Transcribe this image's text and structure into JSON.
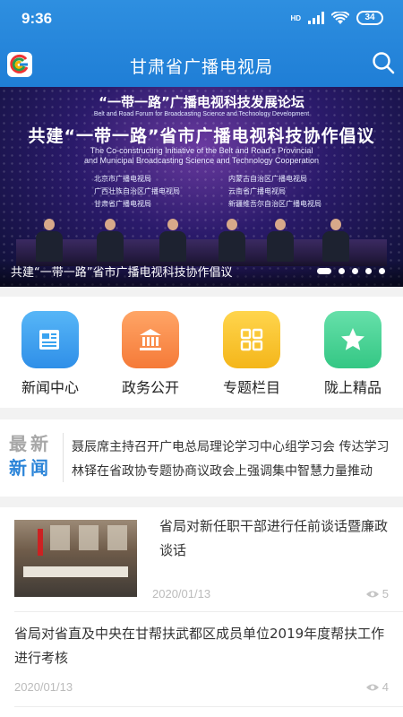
{
  "status_bar": {
    "time": "9:36",
    "network": "HD",
    "battery": "34"
  },
  "app_bar": {
    "title": "甘肃省广播电视局"
  },
  "banner": {
    "forum_title": "“一带一路”广播电视科技发展论坛",
    "forum_title_en": "Belt and Road Forum for Broadcasting Science and Technology Development",
    "headline": "共建“一带一路”省市广播电视科技协作倡议",
    "headline_en_1": "The Co-constructing Initiative of the Belt and Road's Provincial",
    "headline_en_2": "and Municipal Broadcasting Science and Technology Cooperation",
    "orgs_left": [
      "北京市广播电视局",
      "广西壮族自治区广播电视局",
      "甘肃省广播电视局"
    ],
    "orgs_right": [
      "内蒙古自治区广播电视局",
      "云南省广播电视局",
      "新疆维吾尔自治区广播电视局"
    ],
    "caption": "共建“一带一路”省市广播电视科技协作倡议",
    "slide_count": 5,
    "active_slide": 1
  },
  "quick_links": [
    {
      "label": "新闻中心",
      "icon": "newspaper-icon",
      "color": "#3aa3f0"
    },
    {
      "label": "政务公开",
      "icon": "government-building-icon",
      "color": "#f78a45"
    },
    {
      "label": "专题栏目",
      "icon": "grid-icon",
      "color": "#f6c12e"
    },
    {
      "label": "陇上精品",
      "icon": "star-icon",
      "color": "#4fd59a"
    }
  ],
  "latest_news": {
    "tag_top": "最新",
    "tag_bottom": "新闻",
    "items": [
      "聂辰席主持召开广电总局理论学习中心组学习会 传达学习",
      "林铎在省政协专题协商议政会上强调集中智慧力量推动"
    ]
  },
  "news_list": [
    {
      "title": "省局对新任职干部进行任前谈话暨廉政谈话",
      "date": "2020/01/13",
      "views": "5"
    },
    {
      "title": "省局对省直及中央在甘帮扶武都区成员单位2019年度帮扶工作进行考核",
      "date": "2020/01/13",
      "views": "4"
    }
  ],
  "colors": {
    "primary": "#2086d9",
    "tag_blue": "#2b84d8",
    "tag_gray": "#a7a7a7"
  }
}
